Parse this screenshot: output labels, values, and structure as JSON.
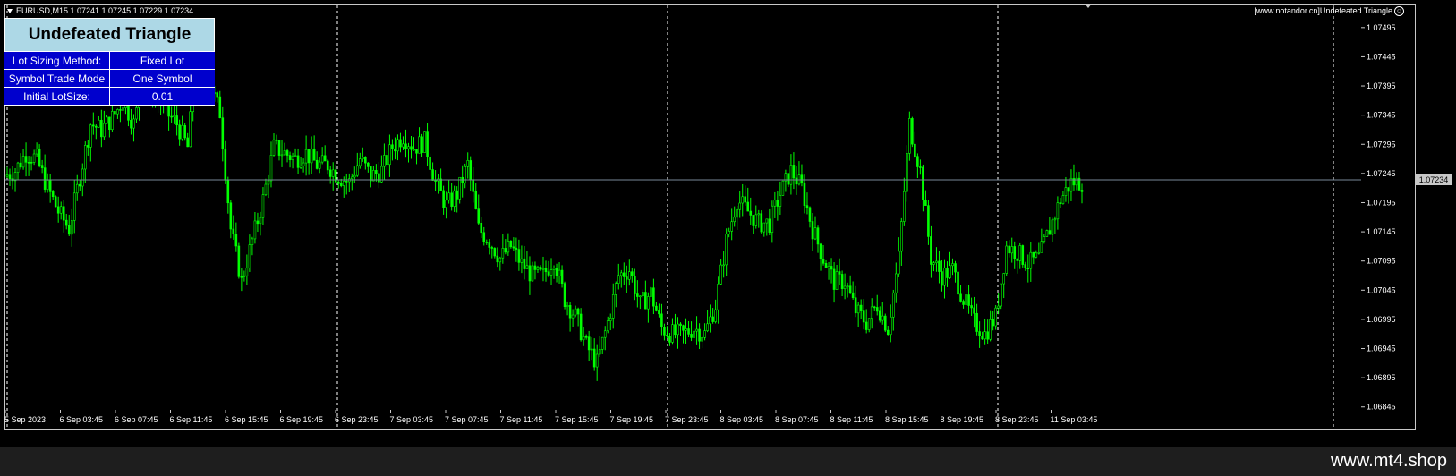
{
  "header": {
    "symbol_line": "EURUSD,M15  1.07241 1.07245 1.07229 1.07234",
    "top_right": "[www.notandor.cn]Undefeated Triangle",
    "smiley_icon": "☺"
  },
  "panel": {
    "title": "Undefeated Triangle",
    "rows": [
      {
        "key": "Lot Sizing Method:",
        "value": "Fixed Lot"
      },
      {
        "key": "Symbol Trade Mode",
        "value": "One Symbol"
      },
      {
        "key": "Initial LotSize:",
        "value": "0.01"
      }
    ]
  },
  "current_price": "1.07234",
  "footer": {
    "watermark": "www.mt4.shop"
  },
  "colors": {
    "candle": "#00ff00",
    "grid_separator": "#ffffff",
    "price_line": "#778899",
    "panel_header": "#add8e6",
    "panel_body": "#0000cd"
  },
  "chart_data": {
    "type": "line",
    "symbol": "EURUSD",
    "timeframe": "M15",
    "price_ticks": [
      "1.07495",
      "1.07445",
      "1.07395",
      "1.07345",
      "1.07295",
      "1.07245",
      "1.07195",
      "1.07145",
      "1.07095",
      "1.07045",
      "1.06995",
      "1.06945",
      "1.06895",
      "1.06845"
    ],
    "time_ticks": [
      "5 Sep 2023",
      "6 Sep 03:45",
      "6 Sep 07:45",
      "6 Sep 11:45",
      "6 Sep 15:45",
      "6 Sep 19:45",
      "6 Sep 23:45",
      "7 Sep 03:45",
      "7 Sep 07:45",
      "7 Sep 11:45",
      "7 Sep 15:45",
      "7 Sep 19:45",
      "7 Sep 23:45",
      "8 Sep 03:45",
      "8 Sep 07:45",
      "8 Sep 11:45",
      "8 Sep 15:45",
      "8 Sep 19:45",
      "8 Sep 23:45",
      "11 Sep 03:45"
    ],
    "day_separators": [
      "6 Sep 23:45",
      "7 Sep 23:45",
      "8 Sep 23:45"
    ],
    "ylim": [
      1.0684,
      1.0753
    ],
    "series": [
      {
        "values": [
          1.0724,
          1.0725,
          1.0728,
          1.0727,
          1.0722,
          1.0718,
          1.0715,
          1.0724,
          1.0733,
          1.0732,
          1.0734,
          1.0737,
          1.0733,
          1.0741,
          1.0738,
          1.0735,
          1.0733,
          1.0729,
          1.0747,
          1.074,
          1.0735,
          1.0715,
          1.0706,
          1.0713,
          1.072,
          1.0729,
          1.0728,
          1.0727,
          1.0728,
          1.0726,
          1.0726,
          1.0724,
          1.0723,
          1.0727,
          1.0724,
          1.0725,
          1.0729,
          1.0731,
          1.0729,
          1.073,
          1.0723,
          1.0719,
          1.0721,
          1.0726,
          1.0715,
          1.0713,
          1.071,
          1.0712,
          1.0709,
          1.0707,
          1.0707,
          1.071,
          1.0703,
          1.07,
          1.0695,
          1.0692,
          1.0699,
          1.0707,
          1.0708,
          1.0702,
          1.0704,
          1.0698,
          1.0697,
          1.0697,
          1.0698,
          1.0697,
          1.0702,
          1.0713,
          1.072,
          1.0718,
          1.0716,
          1.0716,
          1.0721,
          1.0725,
          1.0722,
          1.0715,
          1.071,
          1.0706,
          1.0706,
          1.0701,
          1.0699,
          1.0702,
          1.0698,
          1.071,
          1.0733,
          1.0725,
          1.071,
          1.0707,
          1.0708,
          1.0703,
          1.0699,
          1.0697,
          1.07,
          1.0712,
          1.0711,
          1.0709,
          1.071,
          1.0715,
          1.072,
          1.0723,
          1.0723
        ]
      }
    ]
  }
}
